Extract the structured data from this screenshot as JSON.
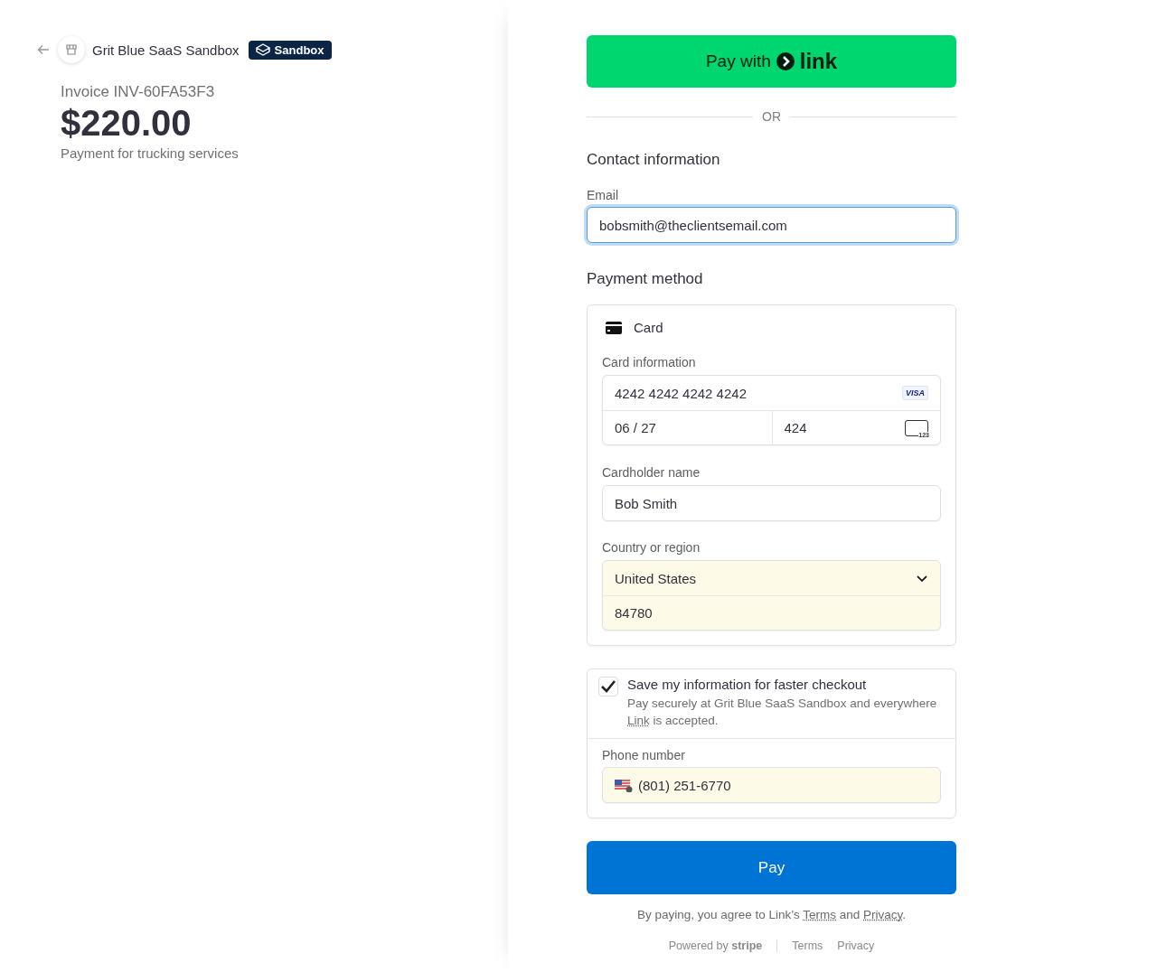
{
  "merchant": {
    "name": "Grit Blue SaaS Sandbox",
    "badge": "Sandbox"
  },
  "invoice": {
    "title": "Invoice INV-60FA53F3",
    "amount": "$220.00",
    "description": "Payment for trucking services"
  },
  "link_button": {
    "label": "Pay with",
    "logo_text": "link"
  },
  "divider": "OR",
  "contact": {
    "heading": "Contact information",
    "email_label": "Email",
    "email_value": "bobsmith@theclientsemail.com",
    "focused": true
  },
  "payment": {
    "heading": "Payment method",
    "method": "Card",
    "card_label": "Card information",
    "card_number": "4242 4242 4242 4242",
    "brand": "VISA",
    "expiry": "06 / 27",
    "cvc": "424",
    "cvc_icon_text": "123",
    "name_label": "Cardholder name",
    "name_value": "Bob Smith",
    "country_label": "Country or region",
    "country_value": "United States",
    "zip_value": "84780",
    "autofilled": true
  },
  "save": {
    "checked": true,
    "title": "Save my information for faster checkout",
    "text_before": "Pay securely at Grit Blue SaaS Sandbox and everywhere",
    "link": "Link",
    "text_after": "is accepted.",
    "phone_label": "Phone number",
    "phone_value": "(801) 251-6770",
    "autofilled": true
  },
  "pay_button": "Pay",
  "consent": {
    "before": "By paying, you agree to Link’s",
    "terms": "Terms",
    "middle": "and",
    "privacy": "Privacy",
    "after": "."
  },
  "footer": {
    "powered": "Powered by",
    "brand": "stripe",
    "links": [
      "Terms",
      "Privacy"
    ]
  }
}
